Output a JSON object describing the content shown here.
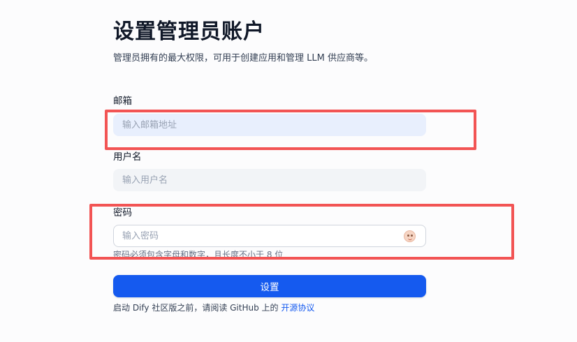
{
  "page": {
    "title": "设置管理员账户",
    "subtitle": "管理员拥有的最大权限，可用于创建应用和管理 LLM 供应商等。"
  },
  "form": {
    "email": {
      "label": "邮箱",
      "placeholder": "输入邮箱地址",
      "value": ""
    },
    "username": {
      "label": "用户名",
      "placeholder": "输入用户名",
      "value": ""
    },
    "password": {
      "label": "密码",
      "placeholder": "输入密码",
      "value": "",
      "hint": "密码必须包含字母和数字，且长度不小于 8 位",
      "toggle_icon": "show-password-icon"
    },
    "submit_label": "设置"
  },
  "footer": {
    "text_before": "启动 Dify 社区版之前，请阅读 GitHub 上的 ",
    "link_label": "开源协议"
  },
  "annotations": {
    "highlight_color": "#f25454"
  },
  "colors": {
    "primary": "#155aef",
    "email_bg": "#e8effd",
    "input_bg": "#f2f4f7"
  }
}
